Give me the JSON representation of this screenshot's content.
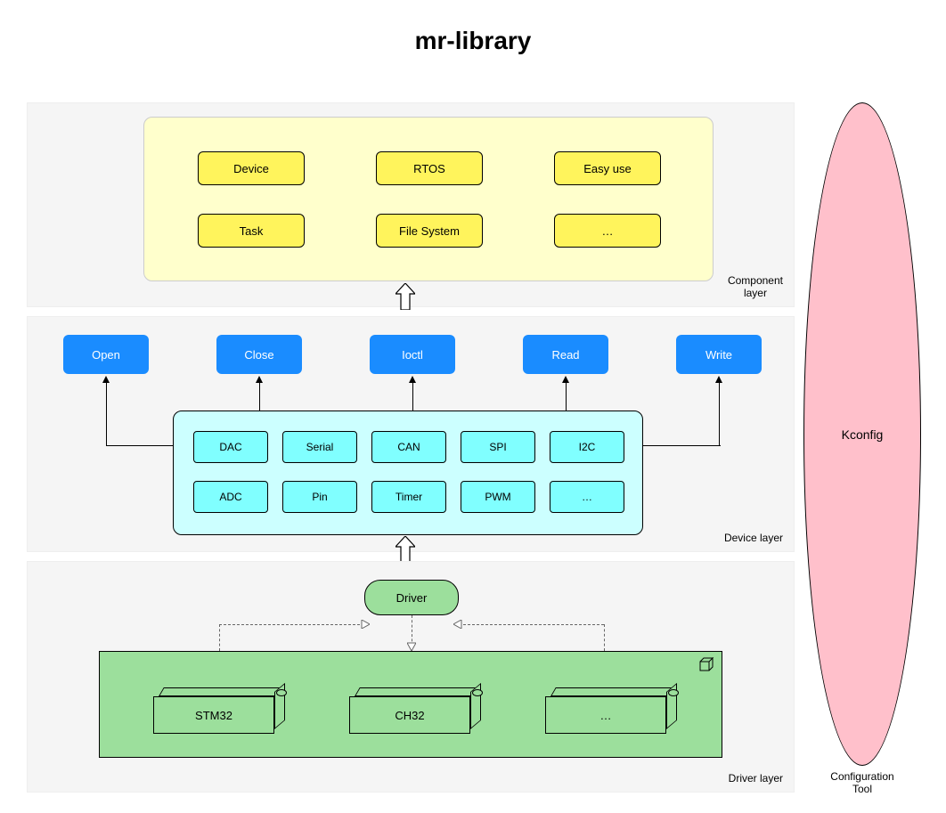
{
  "title": "mr-library",
  "layers": {
    "component": {
      "label": "Component\nlayer",
      "items": [
        "Device",
        "RTOS",
        "Easy use",
        "Task",
        "File System",
        "…"
      ]
    },
    "device": {
      "label": "Device layer",
      "api": [
        "Open",
        "Close",
        "Ioctl",
        "Read",
        "Write"
      ],
      "drivers": [
        "DAC",
        "Serial",
        "CAN",
        "SPI",
        "I2C",
        "ADC",
        "Pin",
        "Timer",
        "PWM",
        "…"
      ]
    },
    "driver": {
      "label": "Driver layer",
      "box": "Driver",
      "hardware": [
        "STM32",
        "CH32",
        "…"
      ]
    }
  },
  "config": {
    "box": "Kconfig",
    "label": "Configuration\nTool"
  }
}
